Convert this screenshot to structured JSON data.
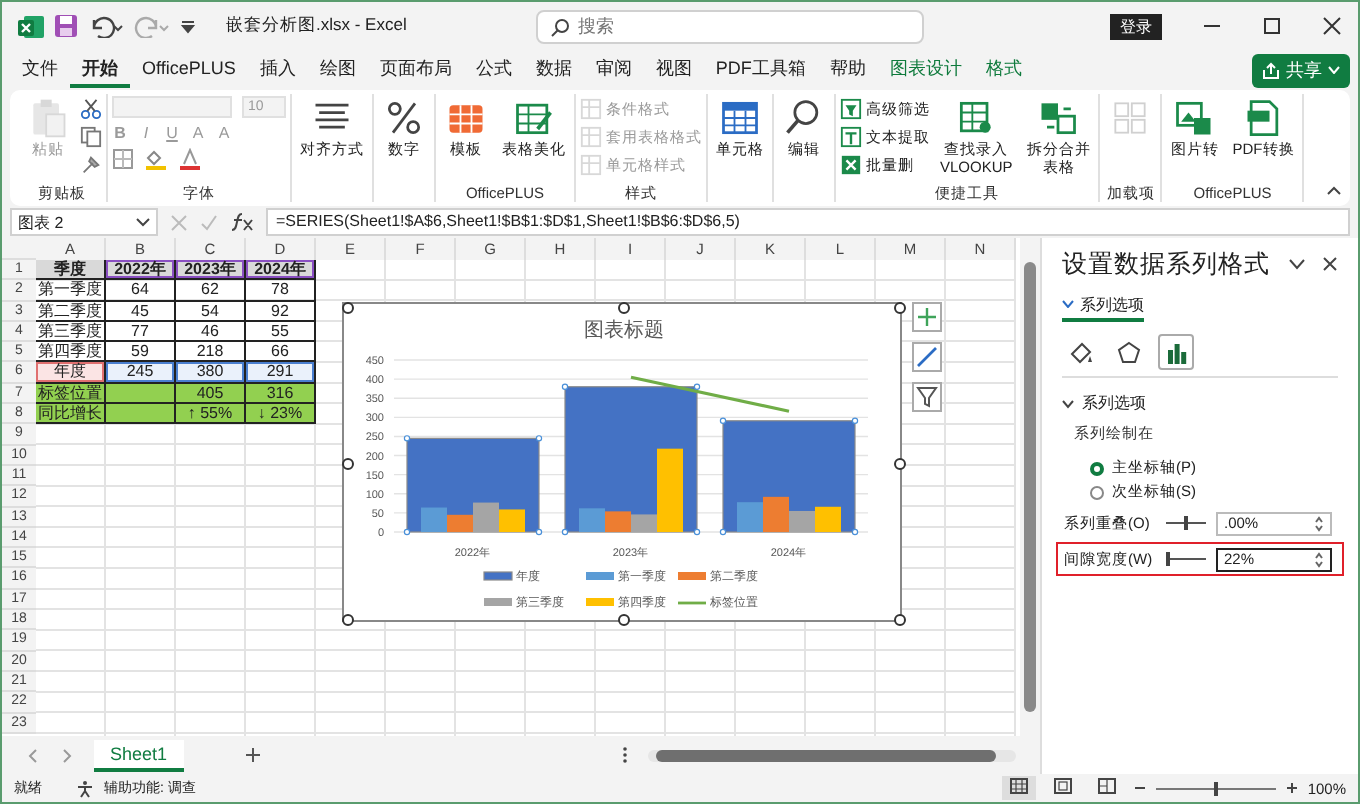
{
  "title_bar": {
    "file_name": "嵌套分析图.xlsx  -  Excel",
    "search": {
      "placeholder": "搜索"
    },
    "login": "登录"
  },
  "menu_tabs": [
    {
      "label": "文件",
      "selected": false,
      "contextual": false
    },
    {
      "label": "开始",
      "selected": true,
      "contextual": false
    },
    {
      "label": "OfficePLUS",
      "selected": false,
      "contextual": false
    },
    {
      "label": "插入",
      "selected": false,
      "contextual": false
    },
    {
      "label": "绘图",
      "selected": false,
      "contextual": false
    },
    {
      "label": "页面布局",
      "selected": false,
      "contextual": false
    },
    {
      "label": "公式",
      "selected": false,
      "contextual": false
    },
    {
      "label": "数据",
      "selected": false,
      "contextual": false
    },
    {
      "label": "审阅",
      "selected": false,
      "contextual": false
    },
    {
      "label": "视图",
      "selected": false,
      "contextual": false
    },
    {
      "label": "PDF工具箱",
      "selected": false,
      "contextual": false
    },
    {
      "label": "帮助",
      "selected": false,
      "contextual": false
    },
    {
      "label": "图表设计",
      "selected": false,
      "contextual": true
    },
    {
      "label": "格式",
      "selected": false,
      "contextual": true
    }
  ],
  "share_button": "共享",
  "ribbon": [
    {
      "label": "剪贴板",
      "items": [
        {
          "kind": "large",
          "label": "粘贴",
          "disabled": true
        }
      ]
    },
    {
      "label": "字体",
      "items": [
        {
          "kind": "font_name",
          "disabled": true
        },
        {
          "kind": "font_size",
          "label": "10",
          "disabled": true
        },
        {
          "kind": "format",
          "label": "B",
          "disabled": true
        },
        {
          "kind": "format",
          "label": "I",
          "disabled": true
        },
        {
          "kind": "format",
          "label": "U",
          "disabled": true
        },
        {
          "kind": "format",
          "label": "A",
          "disabled": true
        },
        {
          "kind": "format",
          "label": "A",
          "disabled": true
        }
      ]
    },
    {
      "items": [
        {
          "kind": "large",
          "label": "对齐方式",
          "disabled": false
        }
      ]
    },
    {
      "items": [
        {
          "kind": "large",
          "label": "数字",
          "disabled": false
        }
      ]
    },
    {
      "label": "OfficePLUS",
      "items": [
        {
          "kind": "large",
          "label": "模板",
          "disabled": false
        },
        {
          "kind": "large",
          "label": "表格美化",
          "disabled": false
        }
      ]
    },
    {
      "label": "样式",
      "items": [
        {
          "kind": "small",
          "label": "条件格式",
          "disabled": true
        },
        {
          "kind": "small",
          "label": "套用表格格式",
          "disabled": true
        },
        {
          "kind": "small",
          "label": "单元格样式",
          "disabled": true
        }
      ]
    },
    {
      "items": [
        {
          "kind": "large",
          "label": "单元格",
          "disabled": false
        }
      ]
    },
    {
      "items": [
        {
          "kind": "large",
          "label": "编辑",
          "disabled": false
        }
      ]
    },
    {
      "label": "便捷工具",
      "items": [
        {
          "kind": "small",
          "label": "高级筛选",
          "disabled": false
        },
        {
          "kind": "small",
          "label": "文本提取",
          "disabled": false
        },
        {
          "kind": "small",
          "label": "批量删",
          "disabled": false
        },
        {
          "kind": "large",
          "label": "查找录入",
          "sublabel": "VLOOKUP",
          "disabled": false
        },
        {
          "kind": "large",
          "label": "拆分合并",
          "sublabel": "表格",
          "disabled": false
        }
      ]
    },
    {
      "label": "加载项",
      "items": [
        {
          "kind": "large",
          "disabled": true
        }
      ]
    },
    {
      "label": "OfficePLUS",
      "items": [
        {
          "kind": "large",
          "label": "图片转",
          "disabled": false
        },
        {
          "kind": "large",
          "label": "PDF转换",
          "disabled": false
        }
      ]
    }
  ],
  "formula_bar": {
    "name_box": "图表 2",
    "formula": "=SERIES(Sheet1!$A$6,Sheet1!$B$1:$D$1,Sheet1!$B$6:$D$6,5)"
  },
  "sheet": {
    "columns": [
      "A",
      "B",
      "C",
      "D",
      "E",
      "F",
      "G",
      "H",
      "I",
      "J",
      "K",
      "L",
      "M",
      "N"
    ],
    "row_numbers": [
      "1",
      "2",
      "3",
      "4",
      "5",
      "6",
      "7",
      "8",
      "9",
      "10",
      "11",
      "12",
      "13",
      "14",
      "15",
      "16",
      "17",
      "18",
      "19",
      "20",
      "21",
      "22",
      "23"
    ],
    "rows": [
      {
        "kind": "header",
        "cells": [
          "季度",
          "2022年",
          "2023年",
          "2024年"
        ]
      },
      {
        "kind": "data",
        "cells": [
          "第一季度",
          "64",
          "62",
          "78"
        ]
      },
      {
        "kind": "data",
        "cells": [
          "第二季度",
          "45",
          "54",
          "92"
        ]
      },
      {
        "kind": "data",
        "cells": [
          "第三季度",
          "77",
          "46",
          "55"
        ]
      },
      {
        "kind": "data",
        "cells": [
          "第四季度",
          "59",
          "218",
          "66"
        ]
      },
      {
        "kind": "series",
        "cells": [
          "年度",
          "245",
          "380",
          "291"
        ]
      },
      {
        "kind": "label",
        "cells": [
          "标签位置",
          "",
          "405",
          "316"
        ]
      },
      {
        "kind": "label",
        "cells": [
          "同比增长",
          "",
          "↑ 55%",
          "↓ 23%"
        ]
      }
    ]
  },
  "chart": {
    "chart_data": {
      "type": "bar",
      "title": "图表标题",
      "grid": true,
      "legend": true,
      "categories": [
        "2022年",
        "2023年",
        "2024年"
      ],
      "ylim": [
        0,
        450
      ],
      "yticks": [
        0,
        50,
        100,
        150,
        200,
        250,
        300,
        350,
        400,
        450
      ],
      "series": [
        {
          "name": "年度",
          "type": "bar",
          "color": "#4472c4",
          "values": [
            245,
            380,
            291
          ]
        },
        {
          "name": "第一季度",
          "type": "bar",
          "color": "#5b9bd5",
          "values": [
            64,
            62,
            78
          ]
        },
        {
          "name": "第二季度",
          "type": "bar",
          "color": "#ed7d31",
          "values": [
            45,
            54,
            92
          ]
        },
        {
          "name": "第三季度",
          "type": "bar",
          "color": "#a5a5a5",
          "values": [
            77,
            46,
            55
          ]
        },
        {
          "name": "第四季度",
          "type": "bar",
          "color": "#ffc000",
          "values": [
            59,
            218,
            66
          ]
        },
        {
          "name": "标签位置",
          "type": "line",
          "color": "#70ad47",
          "values": [
            null,
            405,
            316
          ]
        }
      ]
    }
  },
  "sheet_tabs": [
    {
      "label": "Sheet1",
      "selected": true
    }
  ],
  "format_pane": {
    "title": "设置数据系列格式",
    "tabs": [
      {
        "label": "系列选项",
        "selected": true
      }
    ],
    "icon_tabs": [
      {
        "selected": false
      },
      {
        "selected": false
      },
      {
        "selected": true
      }
    ],
    "section": {
      "label": "系列选项",
      "expanded": true
    },
    "plot_on": "系列绘制在",
    "radios": [
      {
        "label": "主坐标轴(P)",
        "selected": true
      },
      {
        "label": "次坐标轴(S)",
        "selected": false
      }
    ],
    "settings": [
      {
        "label": "系列重叠(O)",
        "value": ".00%",
        "level": 0.5,
        "highlighted": false
      },
      {
        "label": "间隙宽度(W)",
        "value": "22%",
        "level": 0.05,
        "highlighted": true
      }
    ]
  },
  "status_bar": {
    "ready": "就绪",
    "accessibility": "辅助功能: 调查",
    "views": [
      {
        "selected": true
      },
      {
        "selected": false
      },
      {
        "selected": false
      }
    ],
    "zoom": {
      "level": 0.5,
      "reading": "100%"
    }
  }
}
